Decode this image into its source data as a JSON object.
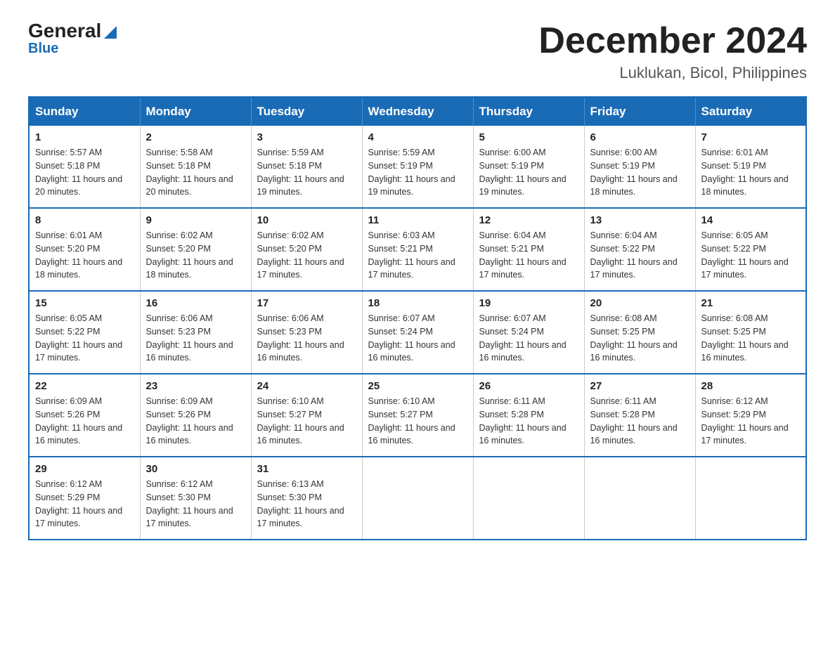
{
  "logo": {
    "general": "General",
    "blue": "Blue"
  },
  "title": "December 2024",
  "subtitle": "Luklukan, Bicol, Philippines",
  "headers": [
    "Sunday",
    "Monday",
    "Tuesday",
    "Wednesday",
    "Thursday",
    "Friday",
    "Saturday"
  ],
  "weeks": [
    [
      {
        "day": "1",
        "sunrise": "5:57 AM",
        "sunset": "5:18 PM",
        "daylight": "11 hours and 20 minutes."
      },
      {
        "day": "2",
        "sunrise": "5:58 AM",
        "sunset": "5:18 PM",
        "daylight": "11 hours and 20 minutes."
      },
      {
        "day": "3",
        "sunrise": "5:59 AM",
        "sunset": "5:18 PM",
        "daylight": "11 hours and 19 minutes."
      },
      {
        "day": "4",
        "sunrise": "5:59 AM",
        "sunset": "5:19 PM",
        "daylight": "11 hours and 19 minutes."
      },
      {
        "day": "5",
        "sunrise": "6:00 AM",
        "sunset": "5:19 PM",
        "daylight": "11 hours and 19 minutes."
      },
      {
        "day": "6",
        "sunrise": "6:00 AM",
        "sunset": "5:19 PM",
        "daylight": "11 hours and 18 minutes."
      },
      {
        "day": "7",
        "sunrise": "6:01 AM",
        "sunset": "5:19 PM",
        "daylight": "11 hours and 18 minutes."
      }
    ],
    [
      {
        "day": "8",
        "sunrise": "6:01 AM",
        "sunset": "5:20 PM",
        "daylight": "11 hours and 18 minutes."
      },
      {
        "day": "9",
        "sunrise": "6:02 AM",
        "sunset": "5:20 PM",
        "daylight": "11 hours and 18 minutes."
      },
      {
        "day": "10",
        "sunrise": "6:02 AM",
        "sunset": "5:20 PM",
        "daylight": "11 hours and 17 minutes."
      },
      {
        "day": "11",
        "sunrise": "6:03 AM",
        "sunset": "5:21 PM",
        "daylight": "11 hours and 17 minutes."
      },
      {
        "day": "12",
        "sunrise": "6:04 AM",
        "sunset": "5:21 PM",
        "daylight": "11 hours and 17 minutes."
      },
      {
        "day": "13",
        "sunrise": "6:04 AM",
        "sunset": "5:22 PM",
        "daylight": "11 hours and 17 minutes."
      },
      {
        "day": "14",
        "sunrise": "6:05 AM",
        "sunset": "5:22 PM",
        "daylight": "11 hours and 17 minutes."
      }
    ],
    [
      {
        "day": "15",
        "sunrise": "6:05 AM",
        "sunset": "5:22 PM",
        "daylight": "11 hours and 17 minutes."
      },
      {
        "day": "16",
        "sunrise": "6:06 AM",
        "sunset": "5:23 PM",
        "daylight": "11 hours and 16 minutes."
      },
      {
        "day": "17",
        "sunrise": "6:06 AM",
        "sunset": "5:23 PM",
        "daylight": "11 hours and 16 minutes."
      },
      {
        "day": "18",
        "sunrise": "6:07 AM",
        "sunset": "5:24 PM",
        "daylight": "11 hours and 16 minutes."
      },
      {
        "day": "19",
        "sunrise": "6:07 AM",
        "sunset": "5:24 PM",
        "daylight": "11 hours and 16 minutes."
      },
      {
        "day": "20",
        "sunrise": "6:08 AM",
        "sunset": "5:25 PM",
        "daylight": "11 hours and 16 minutes."
      },
      {
        "day": "21",
        "sunrise": "6:08 AM",
        "sunset": "5:25 PM",
        "daylight": "11 hours and 16 minutes."
      }
    ],
    [
      {
        "day": "22",
        "sunrise": "6:09 AM",
        "sunset": "5:26 PM",
        "daylight": "11 hours and 16 minutes."
      },
      {
        "day": "23",
        "sunrise": "6:09 AM",
        "sunset": "5:26 PM",
        "daylight": "11 hours and 16 minutes."
      },
      {
        "day": "24",
        "sunrise": "6:10 AM",
        "sunset": "5:27 PM",
        "daylight": "11 hours and 16 minutes."
      },
      {
        "day": "25",
        "sunrise": "6:10 AM",
        "sunset": "5:27 PM",
        "daylight": "11 hours and 16 minutes."
      },
      {
        "day": "26",
        "sunrise": "6:11 AM",
        "sunset": "5:28 PM",
        "daylight": "11 hours and 16 minutes."
      },
      {
        "day": "27",
        "sunrise": "6:11 AM",
        "sunset": "5:28 PM",
        "daylight": "11 hours and 16 minutes."
      },
      {
        "day": "28",
        "sunrise": "6:12 AM",
        "sunset": "5:29 PM",
        "daylight": "11 hours and 17 minutes."
      }
    ],
    [
      {
        "day": "29",
        "sunrise": "6:12 AM",
        "sunset": "5:29 PM",
        "daylight": "11 hours and 17 minutes."
      },
      {
        "day": "30",
        "sunrise": "6:12 AM",
        "sunset": "5:30 PM",
        "daylight": "11 hours and 17 minutes."
      },
      {
        "day": "31",
        "sunrise": "6:13 AM",
        "sunset": "5:30 PM",
        "daylight": "11 hours and 17 minutes."
      },
      null,
      null,
      null,
      null
    ]
  ]
}
